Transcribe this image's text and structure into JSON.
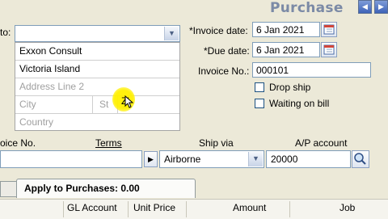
{
  "window": {
    "title": "Purchase"
  },
  "supplier": {
    "to_label": "to:",
    "name_value": "",
    "address_lines": [
      {
        "value": "Exxon Consult",
        "placeholder": false
      },
      {
        "value": "Victoria Island",
        "placeholder": false
      },
      {
        "value": "Address Line 2",
        "placeholder": true
      }
    ],
    "city_placeholder": "City",
    "state_placeholder": "St",
    "zip_value": "Zi",
    "country_placeholder": "Country"
  },
  "header": {
    "invoice_date_label": "*Invoice date:",
    "invoice_date_value": "6 Jan 2021",
    "due_date_label": "*Due date:",
    "due_date_value": "6 Jan 2021",
    "invoice_no_label": "Invoice No.:",
    "invoice_no_value": "000101",
    "drop_ship_label": "Drop ship",
    "waiting_on_bill_label": "Waiting on bill"
  },
  "row": {
    "col_invoice_no": "oice No.",
    "col_terms": "Terms",
    "col_ship_via": "Ship via",
    "col_ap_account": "A/P account",
    "ship_via_value": "Airborne",
    "ap_account_value": "20000"
  },
  "tabs": {
    "active_label": "Apply to Purchases: 0.00"
  },
  "grid": {
    "columns": [
      "GL Account",
      "Unit Price",
      "Amount",
      "Job"
    ]
  },
  "icons": {
    "nav_prev": "arrow-left-icon",
    "nav_next": "arrow-right-icon",
    "dropdown": "chevron-down-icon",
    "calendar": "calendar-icon",
    "search": "search-icon",
    "expand": "arrow-right-icon"
  }
}
